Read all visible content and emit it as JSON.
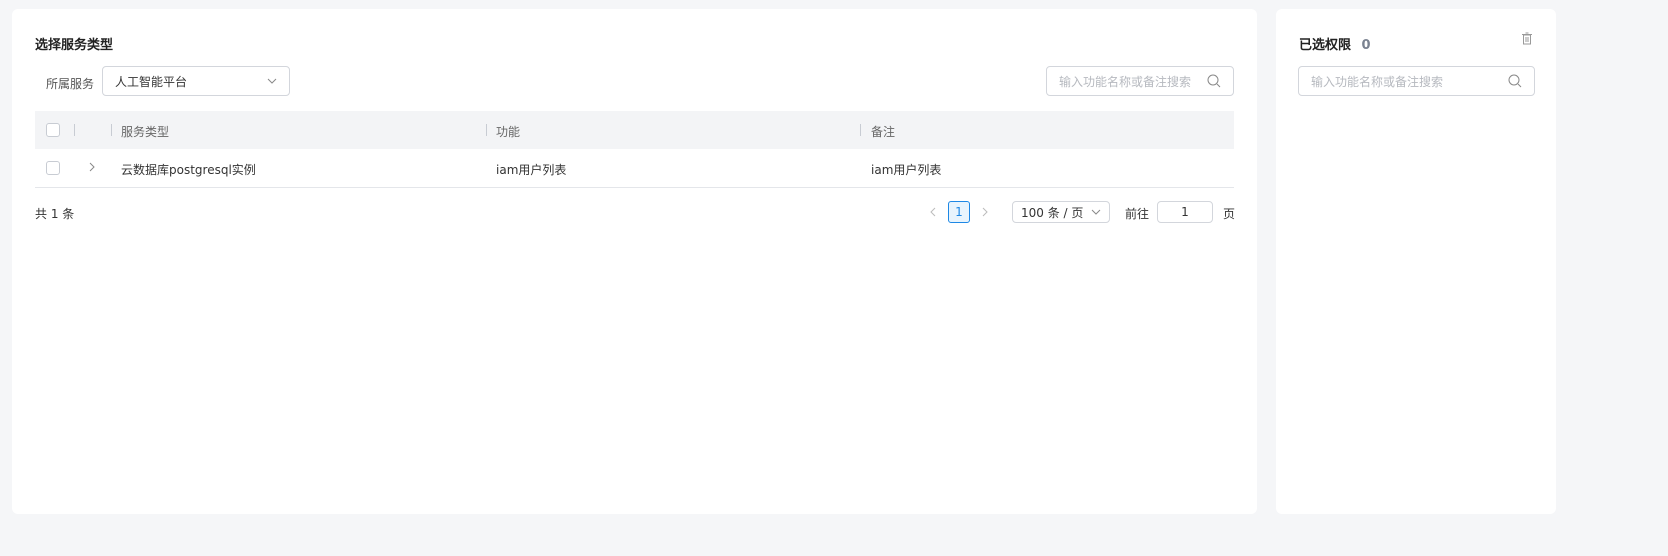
{
  "left": {
    "title": "选择服务类型",
    "service_label": "所属服务",
    "service_value": "人工智能平台",
    "search_placeholder": "输入功能名称或备注搜索",
    "table": {
      "columns": [
        "服务类型",
        "功能",
        "备注"
      ],
      "rows": [
        {
          "service_type": "云数据库postgresql实例",
          "function": "iam用户列表",
          "remark": "iam用户列表"
        }
      ]
    },
    "footer": {
      "total": "共 1 条",
      "current_page": "1",
      "page_size": "100 条 / 页",
      "goto_label": "前往",
      "goto_value": "1",
      "page_suffix": "页"
    }
  },
  "right": {
    "title": "已选权限",
    "count": "0",
    "search_placeholder": "输入功能名称或备注搜索"
  },
  "colors": {
    "accent": "#1e88e5",
    "header_bg": "#f3f4f6"
  }
}
